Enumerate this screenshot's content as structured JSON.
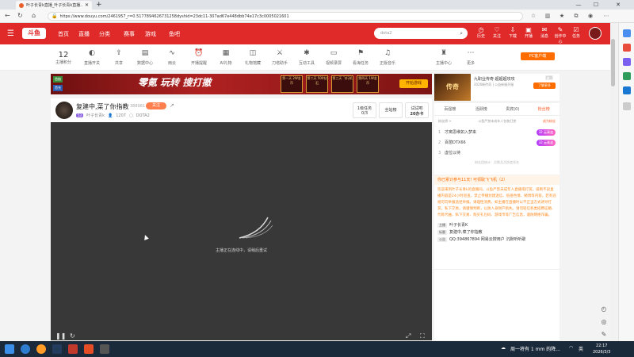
{
  "browser": {
    "tab_title": "叶子长青k直播_叶子长青k直播...",
    "url": "https://www.douyu.com/2461957_r=0.5177894626731258dyshid=23dc11-307ad67e448dbb74e17c3c0005021601"
  },
  "header": {
    "logo": "斗鱼",
    "nav": [
      "首页",
      "直播",
      "分类",
      "赛事",
      "游戏",
      "鱼吧"
    ],
    "search_placeholder": "dota2",
    "right_items": [
      "历史",
      "关注",
      "下载",
      "开播",
      "消息",
      "创作中心",
      "任务"
    ]
  },
  "catbar": {
    "fans_count": "12",
    "fans_label": "主播积分",
    "items": [
      "直播开关",
      "共享",
      "数据中心",
      "雨云",
      "开播提醒",
      "AI礼物",
      "礼物馆藏",
      "刀塔助手",
      "互动工具",
      "视频录屏",
      "看海任务",
      "正版音乐",
      "主播中心",
      "更多"
    ],
    "pc_client": "PC客户端"
  },
  "banner": {
    "tag1": "首抽",
    "tag2": "首充",
    "title": "零氪 玩转 搜打撤",
    "boxes": [
      "第一天 2W金币",
      "第二天 500钻石",
      "第三天 飞行机",
      "第四天 1W金币"
    ],
    "cta": "开始游戏"
  },
  "ad": {
    "image_text": "传奇",
    "title": "九职业传奇·超超超攻攻",
    "desc": "2026新传奇 | 公益新服开服",
    "tag": "广告",
    "button": "了解更多"
  },
  "streamer": {
    "title": "复建中,菜了你指教",
    "room_id": "388981",
    "follow": "关注",
    "level": "53",
    "name": "叶子长青k",
    "viewers": "1207",
    "game": "DOTA2",
    "btn_tasks": "1级任务",
    "btn_tasks_val": "0/3",
    "btn_all": "全站榜",
    "btn_card": "试试吧",
    "btn_card_val": "20办卡"
  },
  "video": {
    "message": "主播正在连线中，请稍后重试"
  },
  "rank": {
    "tabs": [
      "百强榜",
      "活跃榜",
      "贵宾(0)",
      "粉丝榜"
    ],
    "head_left": "粉丝榜 >",
    "head_mid": "斗鱼严禁未成年人包装打赏",
    "head_right": "成为粉丝",
    "rows": [
      {
        "num": "1",
        "name": "才离思维如入梦来",
        "badge": "32 云青涟"
      },
      {
        "num": "2",
        "name": "百憩DTX66",
        "badge": "32 云青涟"
      },
      {
        "num": "3",
        "name": "虚位以待",
        "badge": ""
      }
    ],
    "note": "粉丝团统计：总数及活跃度排名"
  },
  "chat": {
    "top": "你已累计参与11天! 可领取飞飞机（2）",
    "body": "欢迎来到叶子长青k的直播间。斗鱼严禁未成年人直播或打赏。抵制不良直播内容是24小时巡查，禁止传播封建迷信、低俗色情、赌博等内容，若有违规可向举报途径举报。请理性消费，如主播在直播时以不正当方式诱导打赏，私下交易，请谨慎判断，以防人身财产损失。请勿轻信各类招聘征婚、代练代抽、私下交易、购买礼包码、游戏币等广告信息，谨防网络诈骗。",
    "rows": [
      {
        "k": "主播",
        "v": "叶子长青K"
      },
      {
        "k": "标题",
        "v": "复建中,菜了你指教"
      },
      {
        "k": "公告",
        "v": "QQ:394867894 网易云搜用户 沉默听听歌"
      }
    ]
  },
  "taskbar": {
    "weather": "周一将有 1 mm 的降...",
    "time": "22:17",
    "date": "2026/3/3",
    "ime": "英"
  }
}
